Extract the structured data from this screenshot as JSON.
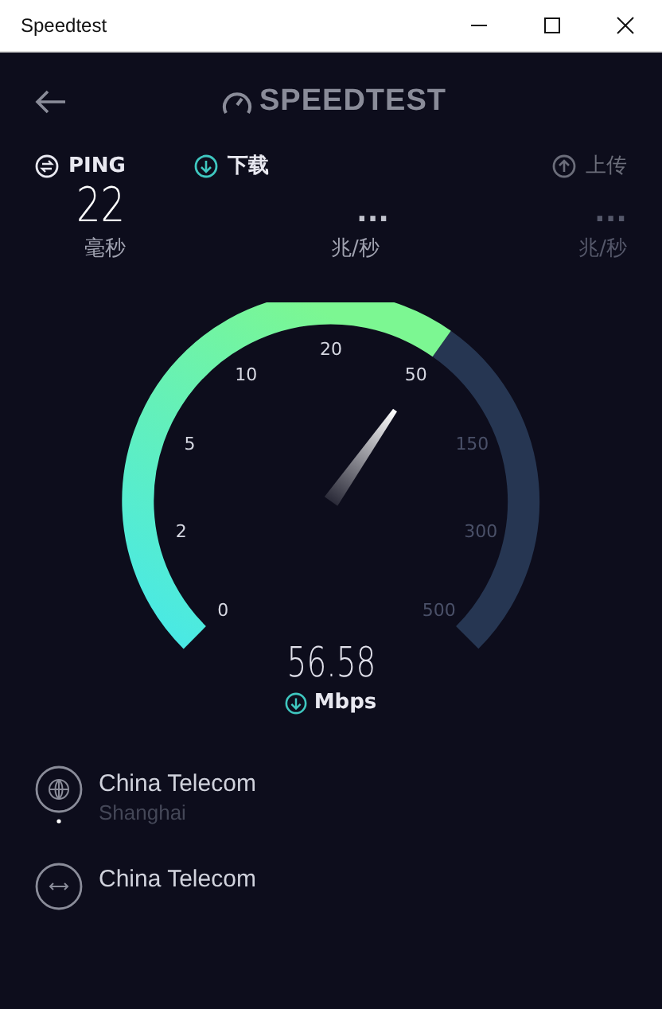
{
  "window": {
    "title": "Speedtest"
  },
  "header": {
    "logo": "SPEEDTEST"
  },
  "metrics": [
    {
      "label": "PING",
      "selected": false,
      "disabled": false,
      "value": "22",
      "unit": "毫秒"
    },
    {
      "label": "下载",
      "selected": true,
      "disabled": false,
      "value": "...",
      "unit": "兆/秒"
    },
    {
      "label": "上传",
      "selected": false,
      "disabled": true,
      "value": "...",
      "unit": "兆/秒"
    }
  ],
  "gauge": {
    "ticks": [
      "0",
      "2",
      "5",
      "10",
      "20",
      "50",
      "150",
      "300",
      "500"
    ],
    "reading": "56.58",
    "unit": "Mbps"
  },
  "servers": [
    {
      "kind": "provider",
      "name": "China Telecom",
      "location": "Shanghai"
    },
    {
      "kind": "host",
      "name": "China Telecom"
    }
  ]
}
